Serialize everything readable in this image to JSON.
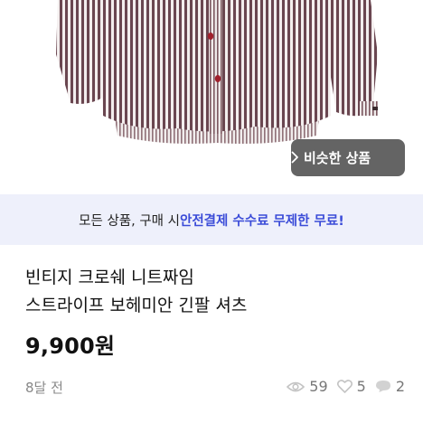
{
  "product": {
    "similar_button_label": "비슷한 상품",
    "banner": {
      "prefix": "모든 상품, 구매 시 ",
      "highlight": "안전결제 수수료 무제한 무료!"
    },
    "title_line1": "빈티지 크로쉐 니트짜임",
    "title_line2": "스트라이프 보헤미안 긴팔 셔츠",
    "price": "9,900원",
    "posted": "8달 전",
    "views": "59",
    "likes": "5",
    "chats": "2"
  },
  "icons": {
    "similar": "chevron-right-icon",
    "views": "eye-icon",
    "likes": "heart-icon",
    "chats": "chat-bubble-icon"
  },
  "colors": {
    "banner_bg": "#eef0fb",
    "banner_highlight": "#3b4cd8",
    "shirt_stripe": "#6a4650",
    "button": "#a0202c"
  }
}
